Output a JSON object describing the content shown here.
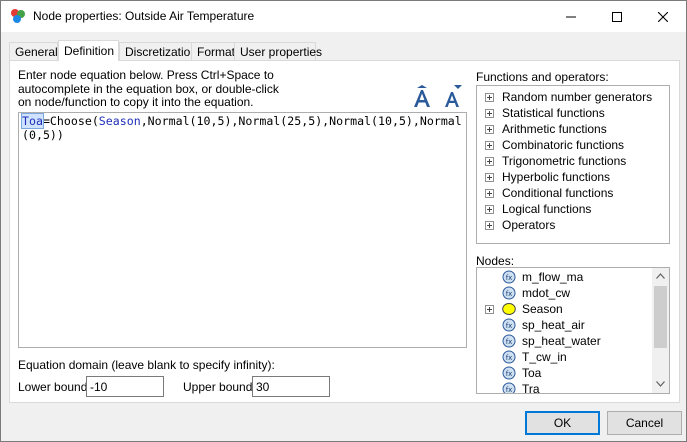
{
  "window": {
    "title": "Node properties: Outside Air Temperature"
  },
  "tabs": [
    {
      "label": "General"
    },
    {
      "label": "Definition"
    },
    {
      "label": "Discretization"
    },
    {
      "label": "Format"
    },
    {
      "label": "User properties"
    }
  ],
  "definition": {
    "instructions_line1": "Enter node equation below. Press Ctrl+Space to",
    "instructions_line2": "autocomplete in the equation box, or double-click",
    "instructions_line3": "on node/function to copy it into the equation.",
    "equation": {
      "target": "Toa",
      "part1": "=Choose(",
      "variable": "Season",
      "part2": ",Normal(10,5),Normal(25,5),Normal(10,5),Normal(0,5))"
    },
    "functions_label": "Functions and operators:",
    "functions": [
      "Random number generators",
      "Statistical functions",
      "Arithmetic functions",
      "Combinatoric functions",
      "Trigonometric functions",
      "Hyperbolic functions",
      "Conditional functions",
      "Logical functions",
      "Operators"
    ],
    "nodes_label": "Nodes:",
    "nodes": [
      "m_flow_ma",
      "mdot_cw",
      "Season",
      "sp_heat_air",
      "sp_heat_water",
      "T_cw_in",
      "Toa",
      "Tra"
    ],
    "domain_label": "Equation domain (leave blank to specify infinity):",
    "lower_label": "Lower bound:",
    "lower_value": "-10",
    "upper_label": "Upper bound:",
    "upper_value": "30"
  },
  "buttons": {
    "ok": "OK",
    "cancel": "Cancel"
  },
  "colors": {
    "accent": "#0078d7",
    "variable": "#1f2fb8"
  }
}
